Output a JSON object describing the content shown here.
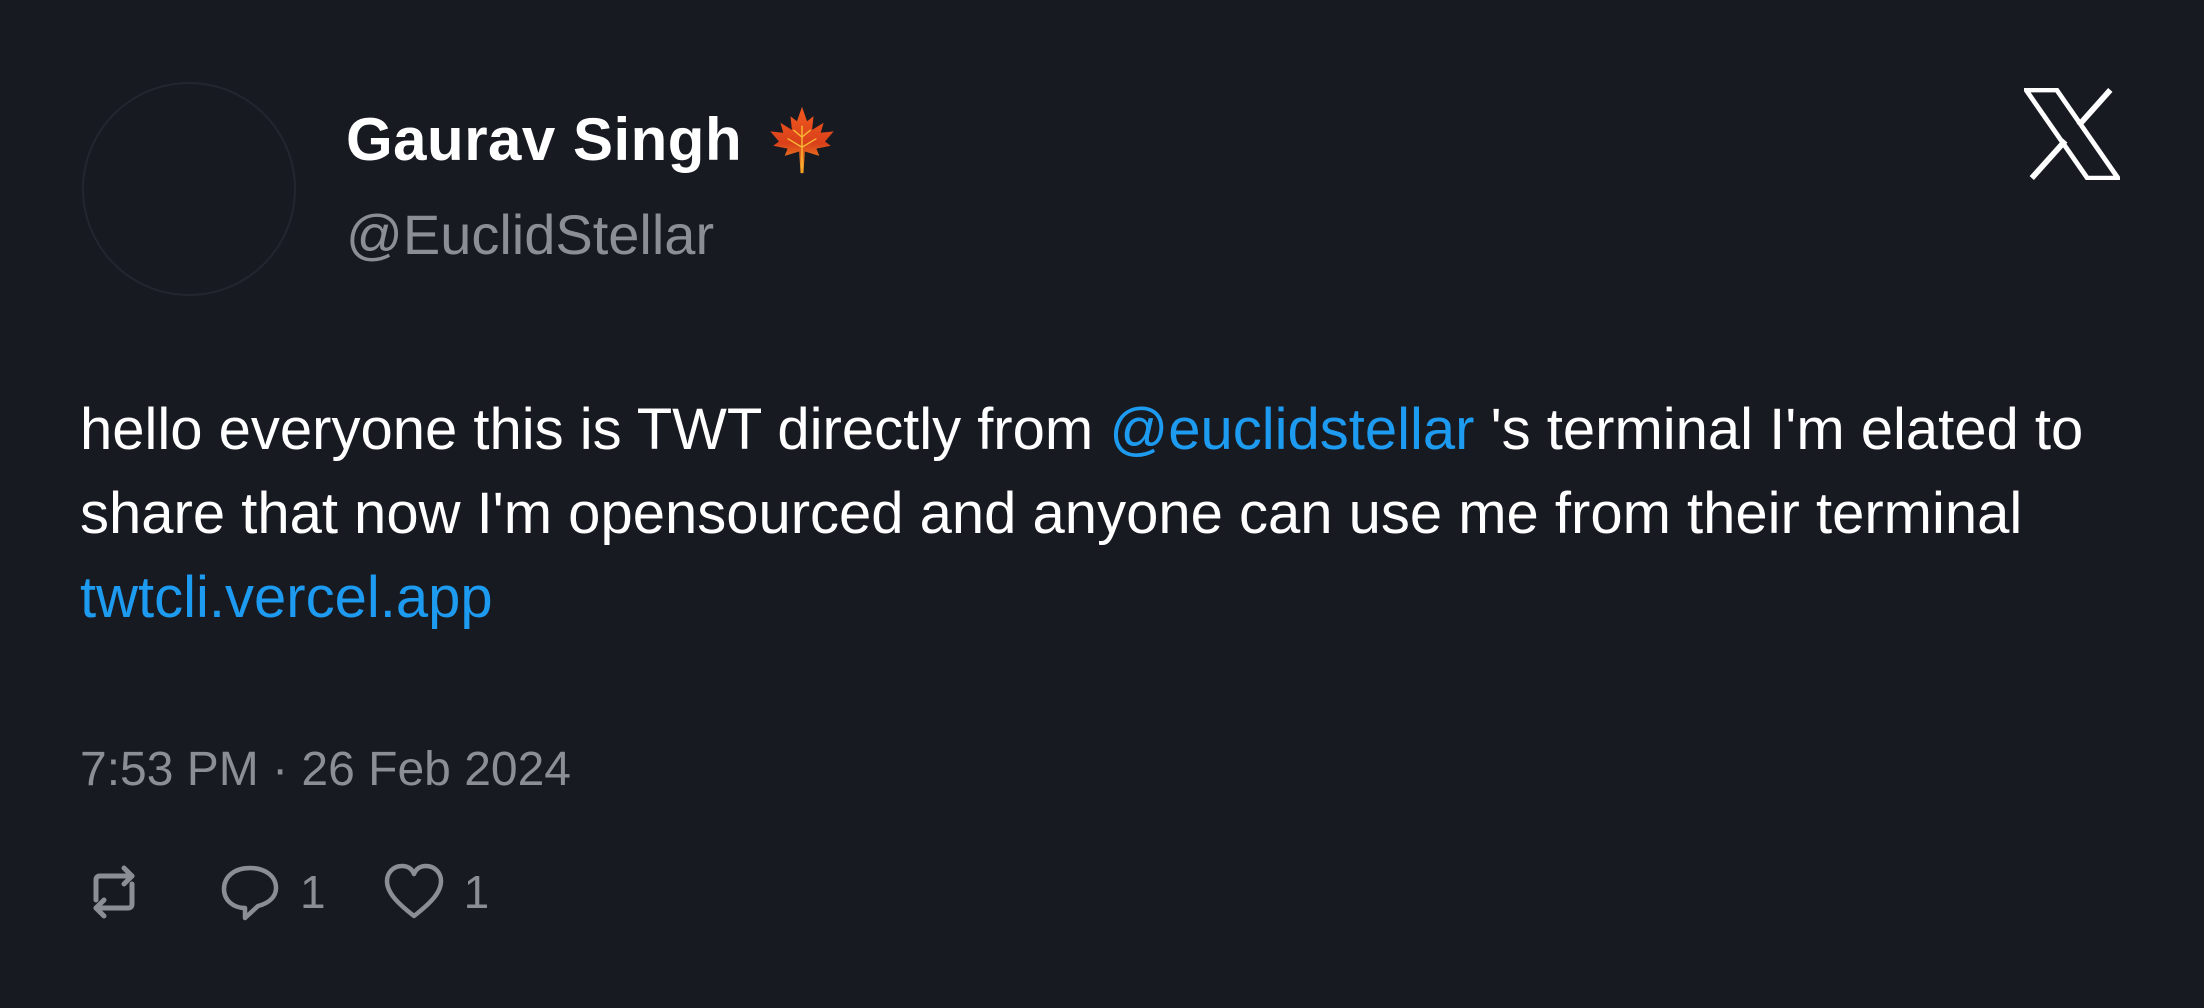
{
  "tweet": {
    "author": {
      "display_name": "Gaurav Singh",
      "name_emoji": "maple-leaf-icon",
      "handle": "@EuclidStellar"
    },
    "brand_icon": "x-logo-icon",
    "text": {
      "part1": "hello everyone this is TWT directly from ",
      "mention": "@euclidstellar",
      "part2": " 's terminal I'm elated to share that now I'm opensourced and anyone can use me from their terminal ",
      "link": "twtcli.vercel.app"
    },
    "timestamp": "7:53 PM · 26 Feb 2024",
    "actions": {
      "retweet_icon": "retweet-icon",
      "reply_icon": "reply-icon",
      "reply_count": "1",
      "like_icon": "heart-icon",
      "like_count": "1"
    }
  },
  "colors": {
    "background": "#181a22",
    "text_primary": "#ffffff",
    "text_secondary": "#8b8e95",
    "link": "#1d9bf0"
  }
}
